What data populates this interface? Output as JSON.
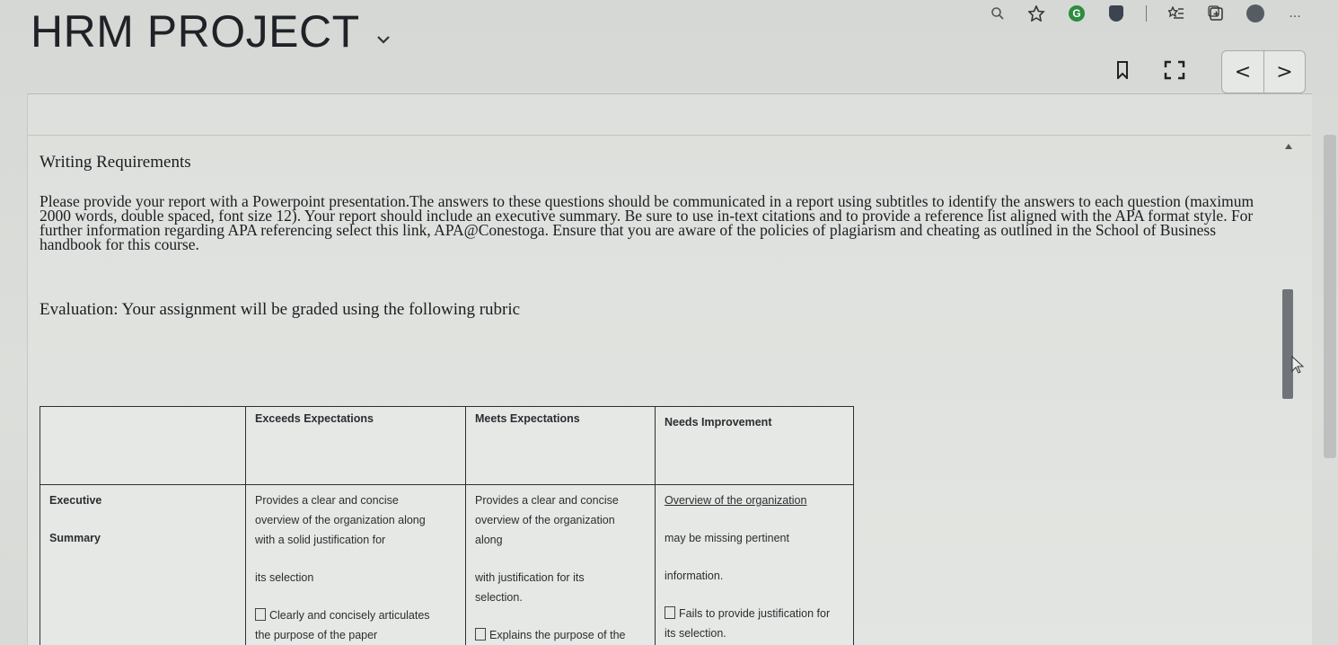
{
  "header": {
    "title": "HRM PROJECT",
    "dropdown_icon": "chevron-down-icon"
  },
  "browser_toolbar": {
    "icons": [
      "zoom-icon",
      "favorite-add-icon",
      "grammarly-icon",
      "shield-extension-icon",
      "favorites-icon",
      "collections-icon",
      "profile-avatar-icon",
      "more-icon"
    ],
    "grammarly_letter": "G",
    "more_label": "..."
  },
  "controls": {
    "prev_label": "<",
    "next_label": ">"
  },
  "document": {
    "heading": "Writing Requirements",
    "body": "Please provide your report with a Powerpoint presentation.The answers to these questions should be communicated in a report using subtitles to identify the answers to each question (maximum 2000 words, double spaced, font size 12). Your report should include an executive summary. Be sure to use in-text citations and to provide a reference list aligned with the APA format style. For further information regarding APA referencing select this link, APA@Conestoga. Ensure that you are aware of the policies of plagiarism and cheating as outlined in the School of Business handbook for this course.",
    "evaluation": "Evaluation: Your assignment will be graded using the following rubric"
  },
  "rubric": {
    "columns": [
      "",
      "Exceeds Expectations",
      "Meets Expectations",
      "Needs Improvement"
    ],
    "row": {
      "criterion_line1": "Executive",
      "criterion_line2": "Summary",
      "exceeds": {
        "l1": "Provides a clear and concise",
        "l2": "overview of the organization along",
        "l3": "with a solid justification for",
        "l4": "its selection",
        "l5": "Clearly and concisely articulates",
        "l6": "the purpose of the paper"
      },
      "meets": {
        "l1": "Provides a clear and concise",
        "l2": "overview of the organization",
        "l3": "along",
        "l4": "with justification for its",
        "l5": "selection.",
        "l6": "Explains the purpose of the"
      },
      "needs": {
        "l1": "Overview of the organization",
        "l2": "may be missing pertinent",
        "l3": "information.",
        "l4": "Fails to provide justification for",
        "l5": "its selection."
      }
    }
  }
}
